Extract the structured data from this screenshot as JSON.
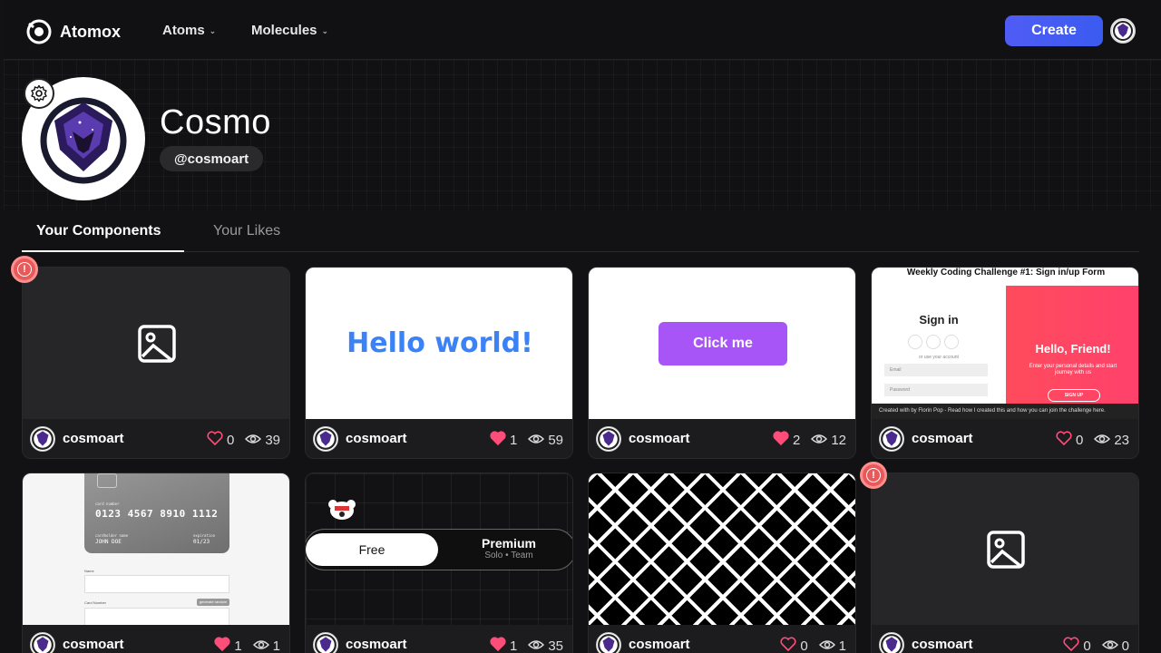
{
  "brand": {
    "name": "Atomox"
  },
  "nav": {
    "atoms_label": "Atoms",
    "molecules_label": "Molecules",
    "create_label": "Create"
  },
  "profile": {
    "name": "Cosmo",
    "handle": "@cosmoart"
  },
  "tabs": {
    "components_label": "Your Components",
    "likes_label": "Your Likes"
  },
  "cards": [
    {
      "author": "cosmoart",
      "likes": "0",
      "views": "39",
      "liked": false,
      "preview": "image-placeholder",
      "warning": true
    },
    {
      "author": "cosmoart",
      "likes": "1",
      "views": "59",
      "liked": true,
      "preview": "hello-world",
      "preview_text": "Hello world!"
    },
    {
      "author": "cosmoart",
      "likes": "2",
      "views": "12",
      "liked": true,
      "preview": "button",
      "preview_text": "Click me"
    },
    {
      "author": "cosmoart",
      "likes": "0",
      "views": "23",
      "liked": false,
      "preview": "signin-form"
    },
    {
      "author": "cosmoart",
      "likes": "1",
      "views": "1",
      "liked": true,
      "preview": "credit-card"
    },
    {
      "author": "cosmoart",
      "likes": "1",
      "views": "35",
      "liked": true,
      "preview": "pricing-toggle"
    },
    {
      "author": "cosmoart",
      "likes": "0",
      "views": "1",
      "liked": false,
      "preview": "pattern"
    },
    {
      "author": "cosmoart",
      "likes": "0",
      "views": "0",
      "liked": false,
      "preview": "image-placeholder",
      "warning": true
    }
  ],
  "signin_preview": {
    "title": "Weekly Coding Challenge #1: Sign in/up Form",
    "heading": "Sign in",
    "sub": "or use your account",
    "email_placeholder": "Email",
    "password_placeholder": "Password",
    "friend_heading": "Hello, Friend!",
    "friend_text": "Enter your personal details and start journey with us",
    "signup_label": "SIGN UP",
    "footer_text": "Created with by Florin Pop - Read how I created this and how you can join the challenge here."
  },
  "card_preview": {
    "number": "0123 4567 8910 1112",
    "number_label": "card number",
    "holder_label": "cardholder name",
    "holder": "JOHN DOE",
    "exp_label": "expiration",
    "exp": "01/23",
    "name_label": "Name",
    "card_number_label": "Card Number",
    "generate_label": "generate random"
  },
  "pricing_preview": {
    "free_label": "Free",
    "premium_label": "Premium",
    "premium_sub": "Solo • Team"
  },
  "colors": {
    "accent": "#4f5cf5",
    "heart": "#ff4d7a",
    "warning": "#e85a5a",
    "hello": "#3b82f6",
    "clickme": "#a855f7"
  }
}
